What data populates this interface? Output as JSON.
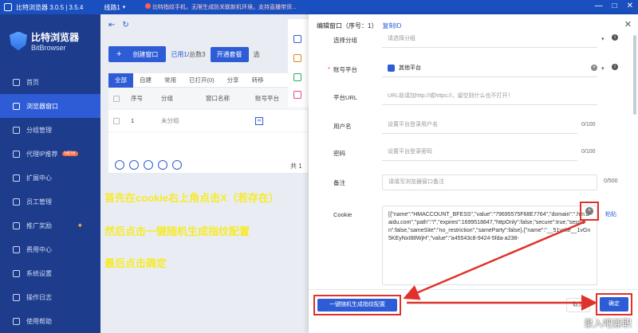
{
  "titlebar": {
    "title": "比特浏览器 3.0.5 | 3.5.4",
    "line": "线路1",
    "notice": "比特指纹手机，无限生成防关联新机环境，支持直播带货...",
    "win_min": "—",
    "win_max": "□",
    "win_close": "✕"
  },
  "brand": {
    "cn": "比特浏览器",
    "en": "BitBrowser"
  },
  "nav": [
    {
      "label": "首页"
    },
    {
      "label": "浏览器窗口"
    },
    {
      "label": "分组管理"
    },
    {
      "label": "代理IP推荐",
      "badge": "NEW"
    },
    {
      "label": "扩展中心"
    },
    {
      "label": "员工管理"
    },
    {
      "label": "推广奖励"
    },
    {
      "label": "费用中心"
    },
    {
      "label": "系统设置"
    },
    {
      "label": "操作日志"
    },
    {
      "label": "使用帮助"
    }
  ],
  "toolbar": {
    "create_label": "创建窗口",
    "used": "已用1",
    "total": "/总数3",
    "open_label": "开通套餐",
    "select_label": "选"
  },
  "tabs": [
    "全部",
    "自建",
    "常用",
    "已打开(0)",
    "分享",
    "转移"
  ],
  "table": {
    "headers": [
      "序号",
      "分组",
      "窗口名称",
      "账号平台"
    ],
    "row": {
      "num": "1",
      "group": "未分组",
      "name": ""
    }
  },
  "pager": "共 1",
  "annotations": [
    "首先在cookie右上角点击X（若存在）",
    "然后点击一键随机生成指纹配置",
    "最后点击确定"
  ],
  "modal": {
    "title": "编辑窗口（序号：1）",
    "copy_id": "复制ID",
    "close": "✕",
    "fields": {
      "group": {
        "label": "选择分组",
        "placeholder": "请选择分组"
      },
      "platform": {
        "label": "账号平台",
        "value": "其他平台"
      },
      "url": {
        "label": "平台URL",
        "placeholder": "URL前请加http://或https://，留空则什么也不打开！"
      },
      "username": {
        "label": "用户名",
        "placeholder": "设置平台登录用户名",
        "count": "0/100"
      },
      "password": {
        "label": "密码",
        "placeholder": "设置平台登录密码",
        "count": "0/100"
      },
      "remark": {
        "label": "备注",
        "placeholder": "请填写浏览器窗口备注",
        "count": "0/500"
      },
      "cookie": {
        "label": "Cookie",
        "value": "[{\"name\":\"HMACCOUNT_BFESS\",\"value\":\"79695575F68E7764\",\"domain\":\".hm.baidu.com\",\"path\":\"/\",\"expires\":1699518847,\"httpOnly\":false,\"secure\":true,\"session\":false,\"sameSite\":\"no_restriction\",\"sameParty\":false},{\"name\":\"__51vcke__1vGn5KEyNxI88WjH\",\"value\":\"a45543c8-9424-5fda-a238-",
        "clear": "×",
        "paste": "粘贴"
      }
    },
    "footer": {
      "fingerprint_label": "一键随机生成指纹配置",
      "cancel_label": "取消",
      "ok_label": "确定"
    }
  },
  "watermark": "录入吧兼职"
}
